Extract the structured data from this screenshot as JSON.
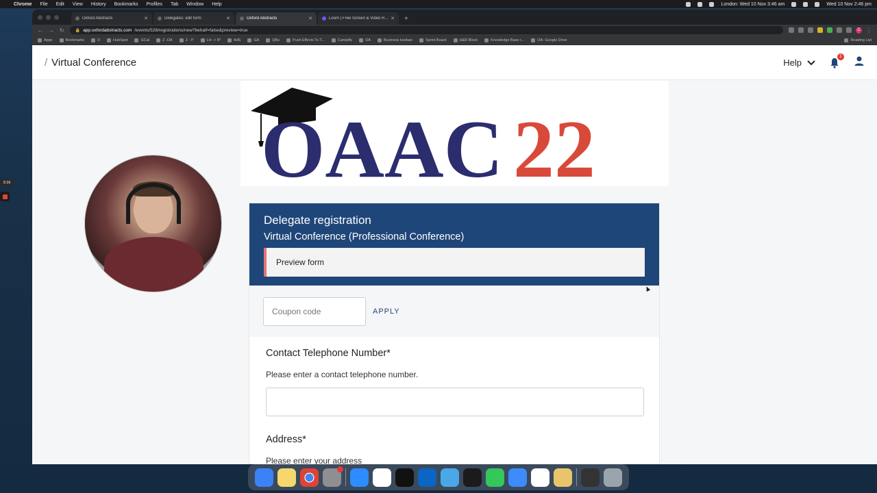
{
  "menubar": {
    "app": "Chrome",
    "items": [
      "File",
      "Edit",
      "View",
      "History",
      "Bookmarks",
      "Profiles",
      "Tab",
      "Window",
      "Help"
    ],
    "clock_london": "London: Wed 10 Nov 3:46 am",
    "clock_local": "Wed 10 Nov 2:46 pm"
  },
  "browser": {
    "tabs": [
      {
        "title": "Oxford Abstracts",
        "active": false
      },
      {
        "title": "Delegates: edit form",
        "active": false
      },
      {
        "title": "Oxford Abstracts",
        "active": true
      },
      {
        "title": "Loom | Free Screen & Video R...",
        "active": false
      }
    ],
    "url_host": "app.oxfordabstracts.com",
    "url_path": "/events/528/registrations/new?behalf=false&preview=true",
    "bookmarks": [
      "Apps",
      "Bookmarks",
      "D",
      "HubSpot",
      "GCal",
      "Z -OA",
      "Z - P",
      "LH -> IP",
      "AdS",
      "GA",
      "QBs",
      "Push Effects To T...",
      "Camplify",
      "OA",
      "Business kanban",
      "Sprint Board",
      "H&R Block",
      "Knowledge Base r...",
      "OA- Google Drive"
    ],
    "reading_list": "Reading List",
    "profile_initial": "C"
  },
  "appbar": {
    "breadcrumb": "Virtual Conference",
    "help_label": "Help",
    "notification_count": "1"
  },
  "banner": {
    "logo_left": "OAAC",
    "logo_right": "22",
    "colors": {
      "left": "#2b2d6e",
      "right": "#d9493a"
    }
  },
  "form": {
    "title": "Delegate registration",
    "subtitle": "Virtual Conference (Professional Conference)",
    "preview_label": "Preview form",
    "coupon_placeholder": "Coupon code",
    "apply_label": "APPLY",
    "fields": [
      {
        "label": "Contact Telephone Number*",
        "help": "Please enter a contact telephone number."
      },
      {
        "label": "Address*",
        "help": "Please enter your address"
      }
    ]
  },
  "recorder": {
    "time": "3:16"
  },
  "colors": {
    "header_blue": "#1f4679",
    "accent_red": "#e57373"
  }
}
